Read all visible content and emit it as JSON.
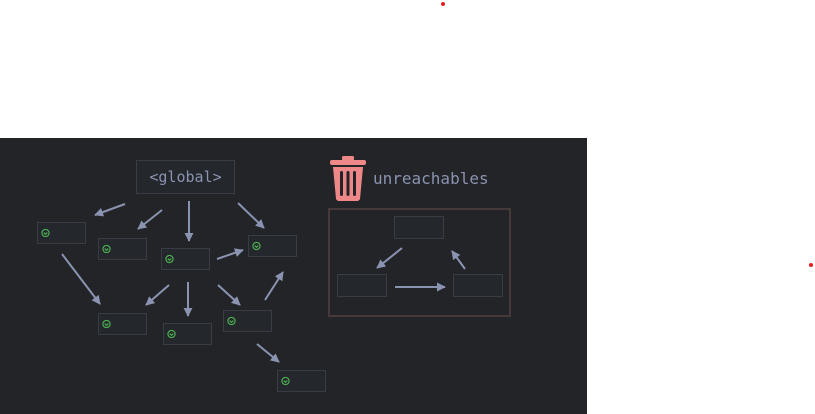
{
  "global_label": "<global>",
  "unreachables_label": "unreachables",
  "colors": {
    "panel": "#232428",
    "arrow": "#8a93b0",
    "node_border": "#383c44",
    "check": "#4caf50",
    "trash": "#ee8888",
    "unreach_border": "#47393a",
    "marker": "#e02020"
  },
  "icons": [
    "check-circle-icon",
    "trash-icon"
  ]
}
